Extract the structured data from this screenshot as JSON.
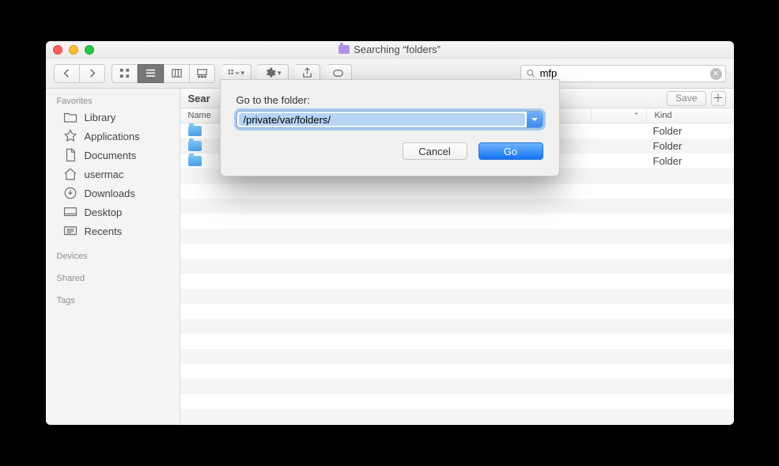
{
  "title": "Searching “folders”",
  "search_query": "mfp",
  "sidebar": {
    "sections": [
      {
        "label": "Favorites",
        "items": [
          {
            "label": "Library"
          },
          {
            "label": "Applications"
          },
          {
            "label": "Documents"
          },
          {
            "label": "usermac"
          },
          {
            "label": "Downloads"
          },
          {
            "label": "Desktop"
          },
          {
            "label": "Recents"
          }
        ]
      },
      {
        "label": "Devices",
        "items": []
      },
      {
        "label": "Shared",
        "items": []
      },
      {
        "label": "Tags",
        "items": []
      }
    ]
  },
  "scopebar": {
    "search_label_truncated": "Sear",
    "save_label": "Save"
  },
  "columns": {
    "name_truncated": "Name",
    "kind": "Kind"
  },
  "rows": [
    {
      "kind": "Folder"
    },
    {
      "kind": "Folder"
    },
    {
      "kind": "Folder"
    }
  ],
  "sheet": {
    "label": "Go to the folder:",
    "value": "/private/var/folders/",
    "cancel": "Cancel",
    "go": "Go"
  }
}
